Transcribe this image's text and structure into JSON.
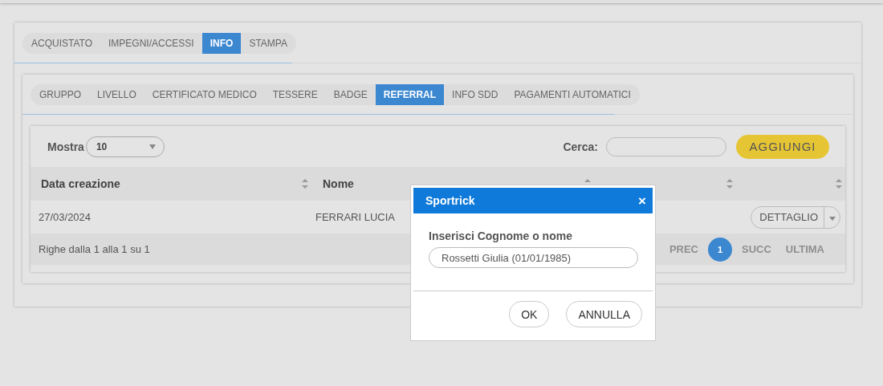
{
  "main_tabs": [
    {
      "label": "ACQUISTATO",
      "selected": false
    },
    {
      "label": "IMPEGNI/ACCESSI",
      "selected": false
    },
    {
      "label": "INFO",
      "selected": true
    },
    {
      "label": "STAMPA",
      "selected": false
    }
  ],
  "sub_tabs": [
    {
      "label": "GRUPPO",
      "selected": false
    },
    {
      "label": "LIVELLO",
      "selected": false
    },
    {
      "label": "CERTIFICATO MEDICO",
      "selected": false
    },
    {
      "label": "TESSERE",
      "selected": false
    },
    {
      "label": "BADGE",
      "selected": false
    },
    {
      "label": "REFERRAL",
      "selected": true
    },
    {
      "label": "INFO SDD",
      "selected": false
    },
    {
      "label": "PAGAMENTI AUTOMATICI",
      "selected": false
    }
  ],
  "toolbar": {
    "show_label": "Mostra",
    "show_value": "10",
    "search_label": "Cerca:",
    "add_button": "AGGIUNGI"
  },
  "table": {
    "columns": [
      {
        "label": "Data creazione"
      },
      {
        "label": "Nome"
      },
      {},
      {}
    ],
    "rows": [
      {
        "cells": [
          "27/03/2024",
          "FERRARI LUCIA"
        ],
        "action": "DETTAGLIO"
      }
    ],
    "info": "Righe dalla 1 alla 1 su 1",
    "pagination": [
      {
        "label": "PREC",
        "kind": "nav",
        "selected": false
      },
      {
        "label": "1",
        "kind": "page",
        "selected": true
      },
      {
        "label": "SUCC",
        "kind": "nav",
        "selected": false
      },
      {
        "label": "ULTIMA",
        "kind": "nav",
        "selected": false
      }
    ]
  },
  "dialog": {
    "title": "Sportrick",
    "close": "×",
    "field_label": "Inserisci Cognome o nome",
    "field_value": "Rossetti Giulia (01/01/1985)",
    "buttons": [
      "OK",
      "ANNULLA"
    ]
  }
}
